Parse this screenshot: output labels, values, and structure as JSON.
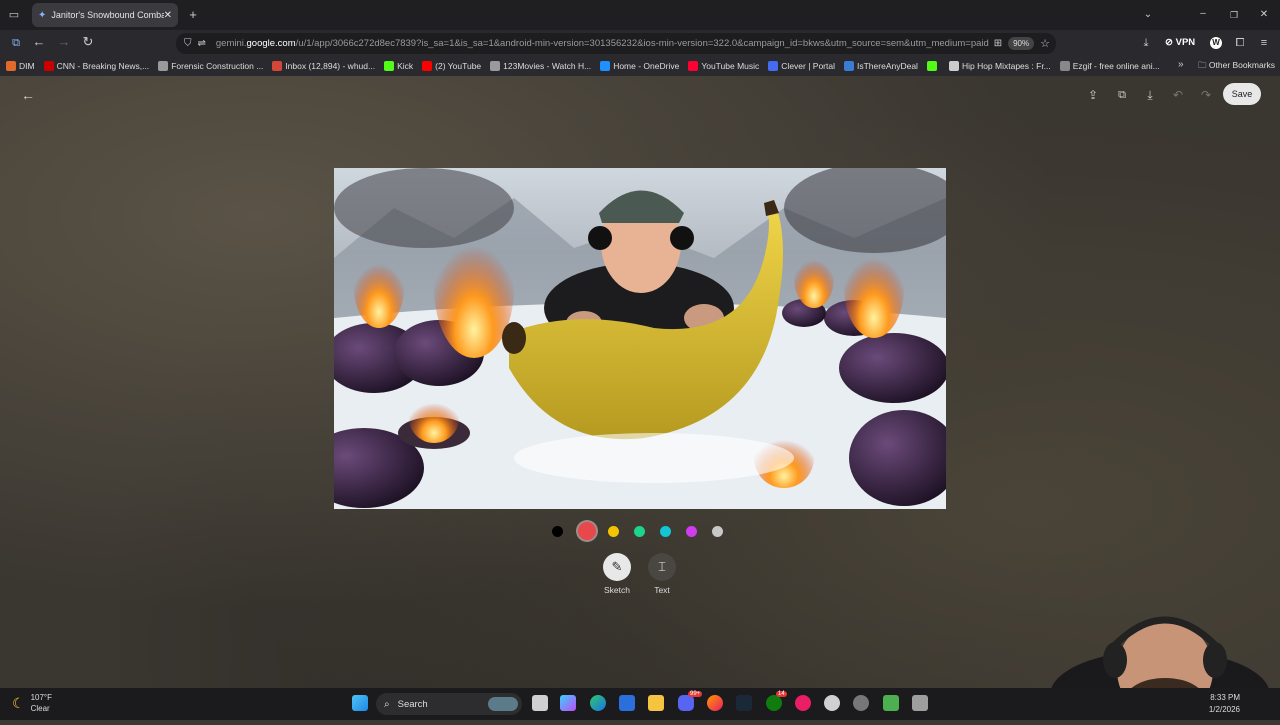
{
  "browser": {
    "tab_title": "Janitor's Snowbound Combat S",
    "url_prefix": "gemini.",
    "url_domain": "google.com",
    "url_rest": "/u/1/app/3066c272d8ec7839?is_sa=1&is_sa=1&android-min-version=301356232&ios-min-version=322.0&campaign_id=bkws&utm_source=sem&utm_medium=paid",
    "zoom": "90%",
    "vpn_label": "VPN",
    "bookmarks": [
      {
        "label": "DIM",
        "color": "#e06a2a"
      },
      {
        "label": "CNN - Breaking News,...",
        "color": "#cc0000"
      },
      {
        "label": "Forensic Construction ...",
        "color": "#9a9a9a"
      },
      {
        "label": "Inbox (12,894) - whud...",
        "color": "#d44638"
      },
      {
        "label": "Kick",
        "color": "#53fc18"
      },
      {
        "label": "(2) YouTube",
        "color": "#ff0000"
      },
      {
        "label": "123Movies - Watch H...",
        "color": "#9a9a9a"
      },
      {
        "label": "Home - OneDrive",
        "color": "#1e90ff"
      },
      {
        "label": "YouTube Music",
        "color": "#ff0033"
      },
      {
        "label": "Clever | Portal",
        "color": "#436cf2"
      },
      {
        "label": "IsThereAnyDeal",
        "color": "#3a7bd5"
      },
      {
        "label": "",
        "color": "#53fc18"
      },
      {
        "label": "Hip Hop Mixtapes : Fr...",
        "color": "#cccccc"
      },
      {
        "label": "Ezgif - free online ani...",
        "color": "#888888"
      }
    ],
    "other_bookmarks": "Other Bookmarks"
  },
  "editor": {
    "save_label": "Save",
    "colors": [
      "#000000",
      "#e8474c",
      "#f5c400",
      "#1ed38a",
      "#12c6d3",
      "#d23cf0",
      "#c8c8c8"
    ],
    "selected_color_index": 1,
    "tools": [
      {
        "label": "Sketch",
        "icon": "sketch-icon",
        "active": true
      },
      {
        "label": "Text",
        "icon": "text-icon",
        "active": false
      }
    ]
  },
  "taskbar": {
    "weather_temp": "107°F",
    "weather_desc": "Clear",
    "search_placeholder": "Search",
    "time": "8:33 PM",
    "date": "1/2/2026",
    "badges": {
      "discord": "99+",
      "xbox": "14"
    }
  }
}
